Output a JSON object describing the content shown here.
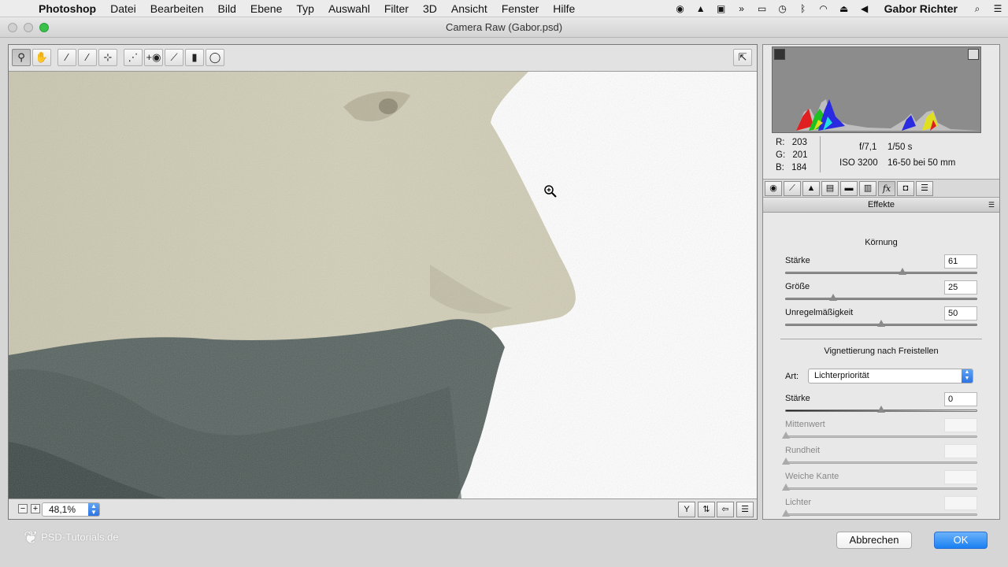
{
  "menubar": {
    "app_name": "Photoshop",
    "items": [
      "Datei",
      "Bearbeiten",
      "Bild",
      "Ebene",
      "Typ",
      "Auswahl",
      "Filter",
      "3D",
      "Ansicht",
      "Fenster",
      "Hilfe"
    ],
    "user": "Gabor Richter"
  },
  "window": {
    "title": "Camera Raw (Gabor.psd)"
  },
  "tools": [
    "zoom-tool-icon",
    "hand-tool-icon",
    "white-balance-tool-icon",
    "color-sampler-tool-icon",
    "targeted-adjustment-tool-icon",
    "crop-tool-icon",
    "spot-removal-tool-icon",
    "red-eye-tool-icon",
    "adjustment-brush-icon",
    "graduated-filter-icon",
    "radial-filter-icon"
  ],
  "zoom": {
    "value": "48,1%"
  },
  "readout": {
    "r_label": "R:",
    "r_value": "203",
    "g_label": "G:",
    "g_value": "201",
    "b_label": "B:",
    "b_value": "184",
    "aperture": "f/7,1",
    "shutter": "1/50 s",
    "iso": "ISO 3200",
    "lens": "16-50 bei 50 mm"
  },
  "panel": {
    "title": "Effekte",
    "grain": {
      "title": "Körnung",
      "staerke_label": "Stärke",
      "staerke_value": "61",
      "staerke_pos": 0.61,
      "groesse_label": "Größe",
      "groesse_value": "25",
      "groesse_pos": 0.25,
      "unreg_label": "Unregelmäßigkeit",
      "unreg_value": "50",
      "unreg_pos": 0.5
    },
    "vignette": {
      "title": "Vignettierung nach Freistellen",
      "art_label": "Art:",
      "art_value": "Lichterpriorität",
      "staerke_label": "Stärke",
      "staerke_value": "0",
      "mittenwert_label": "Mittenwert",
      "rundheit_label": "Rundheit",
      "weiche_label": "Weiche Kante",
      "lichter_label": "Lichter"
    }
  },
  "buttons": {
    "cancel": "Abbrechen",
    "ok": "OK"
  },
  "watermark": "PSD-Tutorials.de"
}
